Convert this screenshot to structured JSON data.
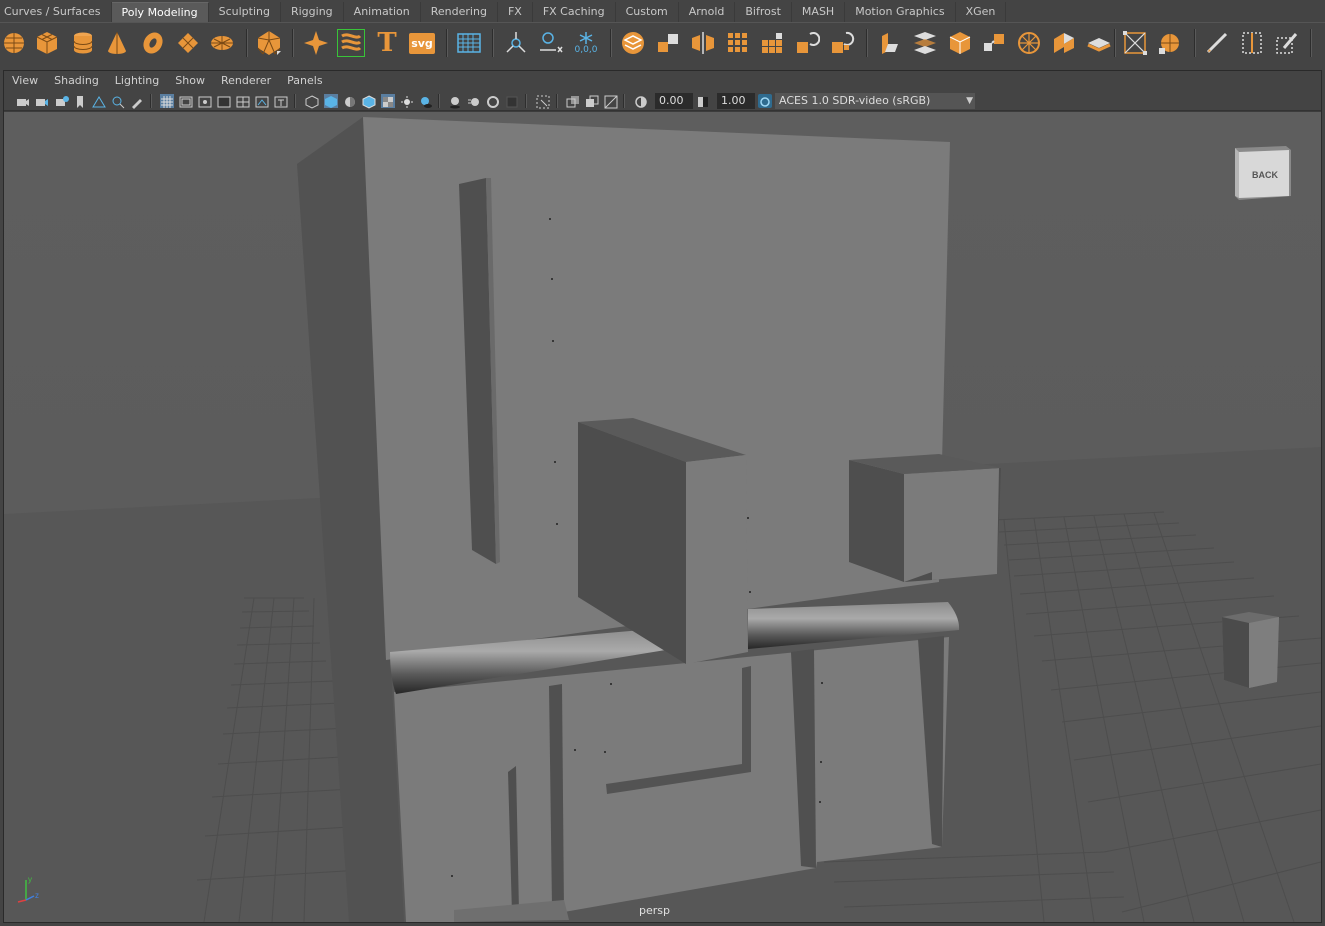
{
  "shelf_tabs": [
    {
      "label": "Curves / Surfaces",
      "active": false
    },
    {
      "label": "Poly Modeling",
      "active": true
    },
    {
      "label": "Sculpting",
      "active": false
    },
    {
      "label": "Rigging",
      "active": false
    },
    {
      "label": "Animation",
      "active": false
    },
    {
      "label": "Rendering",
      "active": false
    },
    {
      "label": "FX",
      "active": false
    },
    {
      "label": "FX Caching",
      "active": false
    },
    {
      "label": "Custom",
      "active": false
    },
    {
      "label": "Arnold",
      "active": false
    },
    {
      "label": "Bifrost",
      "active": false
    },
    {
      "label": "MASH",
      "active": false
    },
    {
      "label": "Motion Graphics",
      "active": false
    },
    {
      "label": "XGen",
      "active": false
    }
  ],
  "shelf_icons": {
    "text_tool_glyph": "T",
    "svg_tool_label": "svg",
    "snap_readout": "0,0,0"
  },
  "panel_menu": [
    "View",
    "Shading",
    "Lighting",
    "Show",
    "Renderer",
    "Panels"
  ],
  "panel_toolbar": {
    "exposure_value": "0.00",
    "gamma_value": "1.00",
    "color_space": "ACES 1.0 SDR-video (sRGB)"
  },
  "viewport": {
    "camera_label": "persp",
    "viewcube_face": "BACK",
    "axis_y": "y",
    "axis_z": "z"
  },
  "colors": {
    "accent_orange": "#e8963a",
    "accent_blue": "#5ab4e6",
    "panel_bg": "#444444",
    "viewport_bg": "#5b5b5b",
    "grid": "#4e4e4e"
  }
}
